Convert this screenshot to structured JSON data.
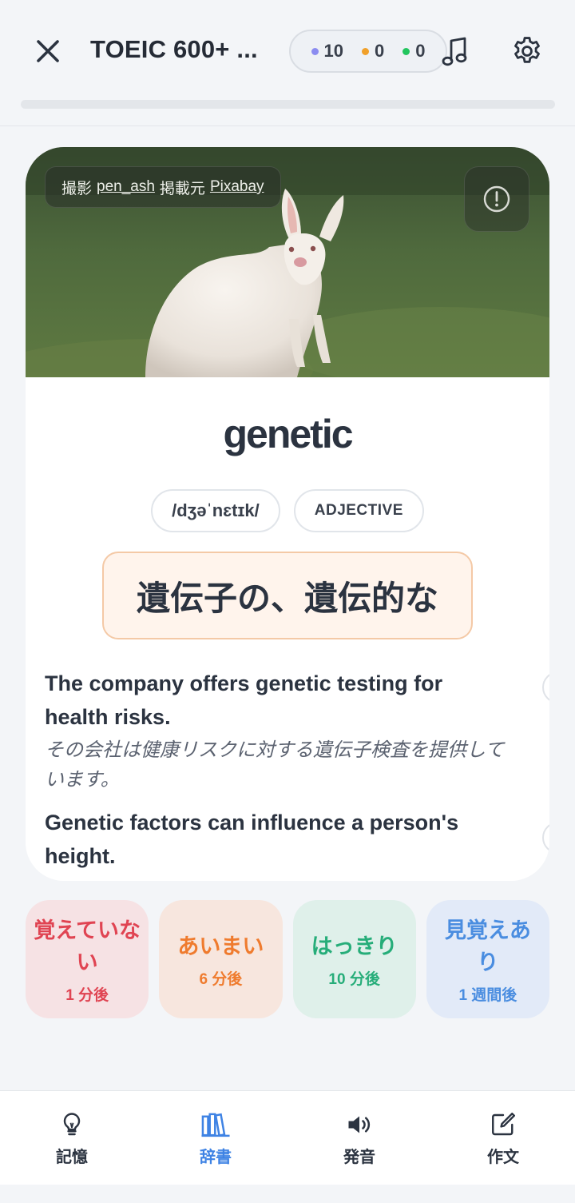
{
  "header": {
    "title": "TOEIC 600+ ...",
    "counts": [
      {
        "value": "10",
        "color": "#8b8cf0"
      },
      {
        "value": "0",
        "color": "#f0a02a"
      },
      {
        "value": "0",
        "color": "#22c55e"
      }
    ],
    "progress_fraction": 0.0,
    "icons": {
      "close": "close-icon",
      "music": "music-note-icon",
      "settings": "gear-icon"
    }
  },
  "card": {
    "credit": {
      "prefix": "撮影",
      "author": "pen_ash",
      "middle": "掲載元",
      "source": "Pixabay"
    },
    "word": "genetic",
    "ipa": "/dʒəˈnɛtɪk/",
    "pos": "ADJECTIVE",
    "meaning": "遺伝子の、遺伝的な",
    "examples": [
      {
        "en": "The company offers genetic testing for health risks.",
        "ja": "その会社は健康リスクに対する遺伝子検査を提供しています。"
      },
      {
        "en": "Genetic factors can influence a person's height.",
        "ja": ""
      }
    ]
  },
  "answers": [
    {
      "label": "覚えていない",
      "time": "1 分後"
    },
    {
      "label": "あいまい",
      "time": "6 分後"
    },
    {
      "label": "はっきり",
      "time": "10 分後"
    },
    {
      "label": "見覚えあり",
      "time": "1 週間後"
    }
  ],
  "nav": [
    {
      "label": "記憶",
      "icon": "lightbulb-icon",
      "active": false
    },
    {
      "label": "辞書",
      "icon": "books-icon",
      "active": true
    },
    {
      "label": "発音",
      "icon": "speaker-icon",
      "active": false
    },
    {
      "label": "作文",
      "icon": "edit-icon",
      "active": false
    }
  ],
  "colors": {
    "accent": "#3f83e4",
    "meaning_border": "#f4c9a6",
    "meaning_bg": "#fff4ec"
  }
}
